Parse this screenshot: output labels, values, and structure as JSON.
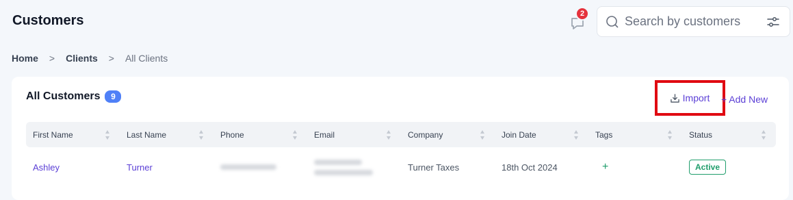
{
  "header": {
    "title": "Customers",
    "notification_count": "2",
    "search": {
      "placeholder": "Search by customers",
      "value": ""
    }
  },
  "breadcrumb": [
    {
      "label": "Home"
    },
    {
      "label": "Clients"
    },
    {
      "label": "All Clients"
    }
  ],
  "breadcrumb_sep": ">",
  "card": {
    "title": "All Customers",
    "count": "9",
    "import_label": "Import",
    "add_new_label": "+ Add New"
  },
  "table": {
    "columns": [
      "First Name",
      "Last Name",
      "Phone",
      "Email",
      "Company",
      "Join Date",
      "Tags",
      "Status"
    ],
    "rows": [
      {
        "first_name": "Ashley",
        "last_name": "Turner",
        "company": "Turner Taxes",
        "join_date": "18th Oct 2024",
        "tags_add": "+",
        "status": "Active"
      }
    ]
  },
  "colors": {
    "accent": "#5b3fd6",
    "badge_blue": "#4f80f7",
    "notification_red": "#e5323c",
    "status_green": "#1f9d6b",
    "highlight_red": "#e00a12"
  },
  "icons": {
    "notification": "chat-bubble-icon",
    "search": "search-icon",
    "filter": "sliders-icon",
    "import": "download-icon",
    "sort": "sort-arrows-icon"
  }
}
